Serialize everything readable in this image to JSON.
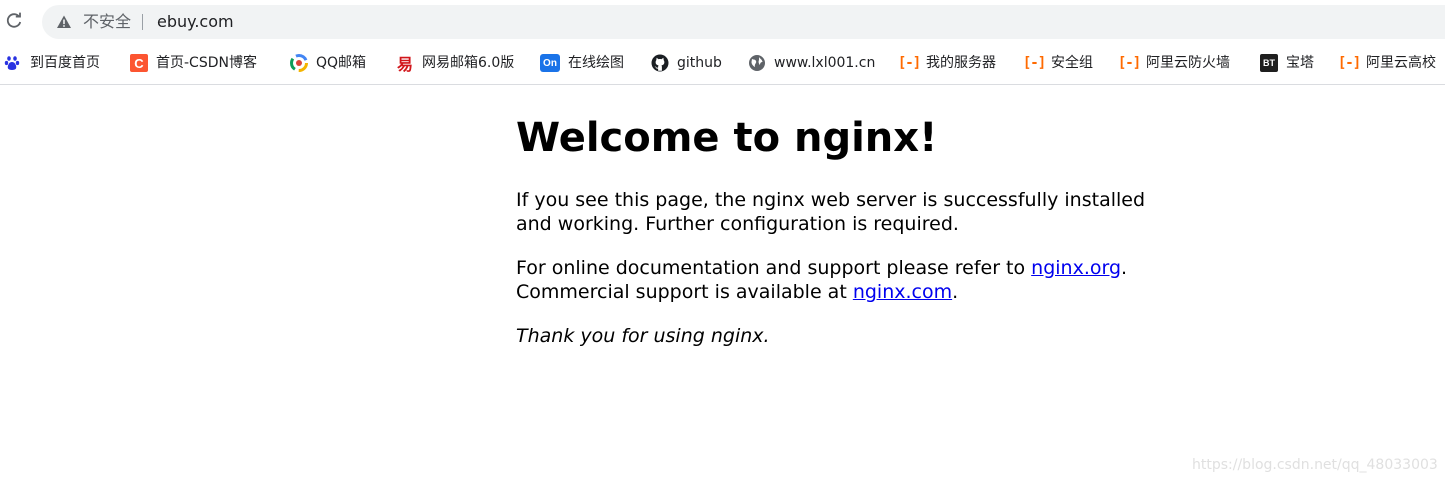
{
  "browser": {
    "security_label": "不安全",
    "address_bar_url": "ebuy.com"
  },
  "bookmarks": [
    {
      "label": "到百度首页",
      "icon": "baidu-paw-icon"
    },
    {
      "label": "首页-CSDN博客",
      "icon": "csdn-icon",
      "icon_text": "C"
    },
    {
      "label": "QQ邮箱",
      "icon": "qq-mail-icon"
    },
    {
      "label": "网易邮箱6.0版",
      "icon": "netease-mail-icon",
      "icon_text": "易"
    },
    {
      "label": "在线绘图",
      "icon": "processon-icon",
      "icon_text": "On"
    },
    {
      "label": "github",
      "icon": "github-icon"
    },
    {
      "label": "www.lxl001.cn",
      "icon": "globe-icon"
    },
    {
      "label": "我的服务器",
      "icon": "aliyun-icon",
      "icon_text": "[-]"
    },
    {
      "label": "安全组",
      "icon": "aliyun-icon",
      "icon_text": "[-]"
    },
    {
      "label": "阿里云防火墙",
      "icon": "aliyun-icon",
      "icon_text": "[-]"
    },
    {
      "label": "宝塔",
      "icon": "bt-panel-icon",
      "icon_text": "BT"
    },
    {
      "label": "阿里云高校",
      "icon": "aliyun-icon",
      "icon_text": "[-]"
    }
  ],
  "page": {
    "heading": "Welcome to nginx!",
    "para1": "If you see this page, the nginx web server is successfully installed and working. Further configuration is required.",
    "para2_prefix": "For online documentation and support please refer to ",
    "link_org": "nginx.org",
    "para2_mid": ".",
    "para2_line2_prefix": "Commercial support is available at ",
    "link_com": "nginx.com",
    "para2_suffix": ".",
    "thanks": "Thank you for using nginx."
  },
  "watermark": "https://blog.csdn.net/qq_48033003",
  "colors": {
    "link": "#0000ee",
    "aliyun_orange": "#ff6a00",
    "csdn_red": "#fc5531",
    "omnibox_bg": "#f1f3f4"
  }
}
